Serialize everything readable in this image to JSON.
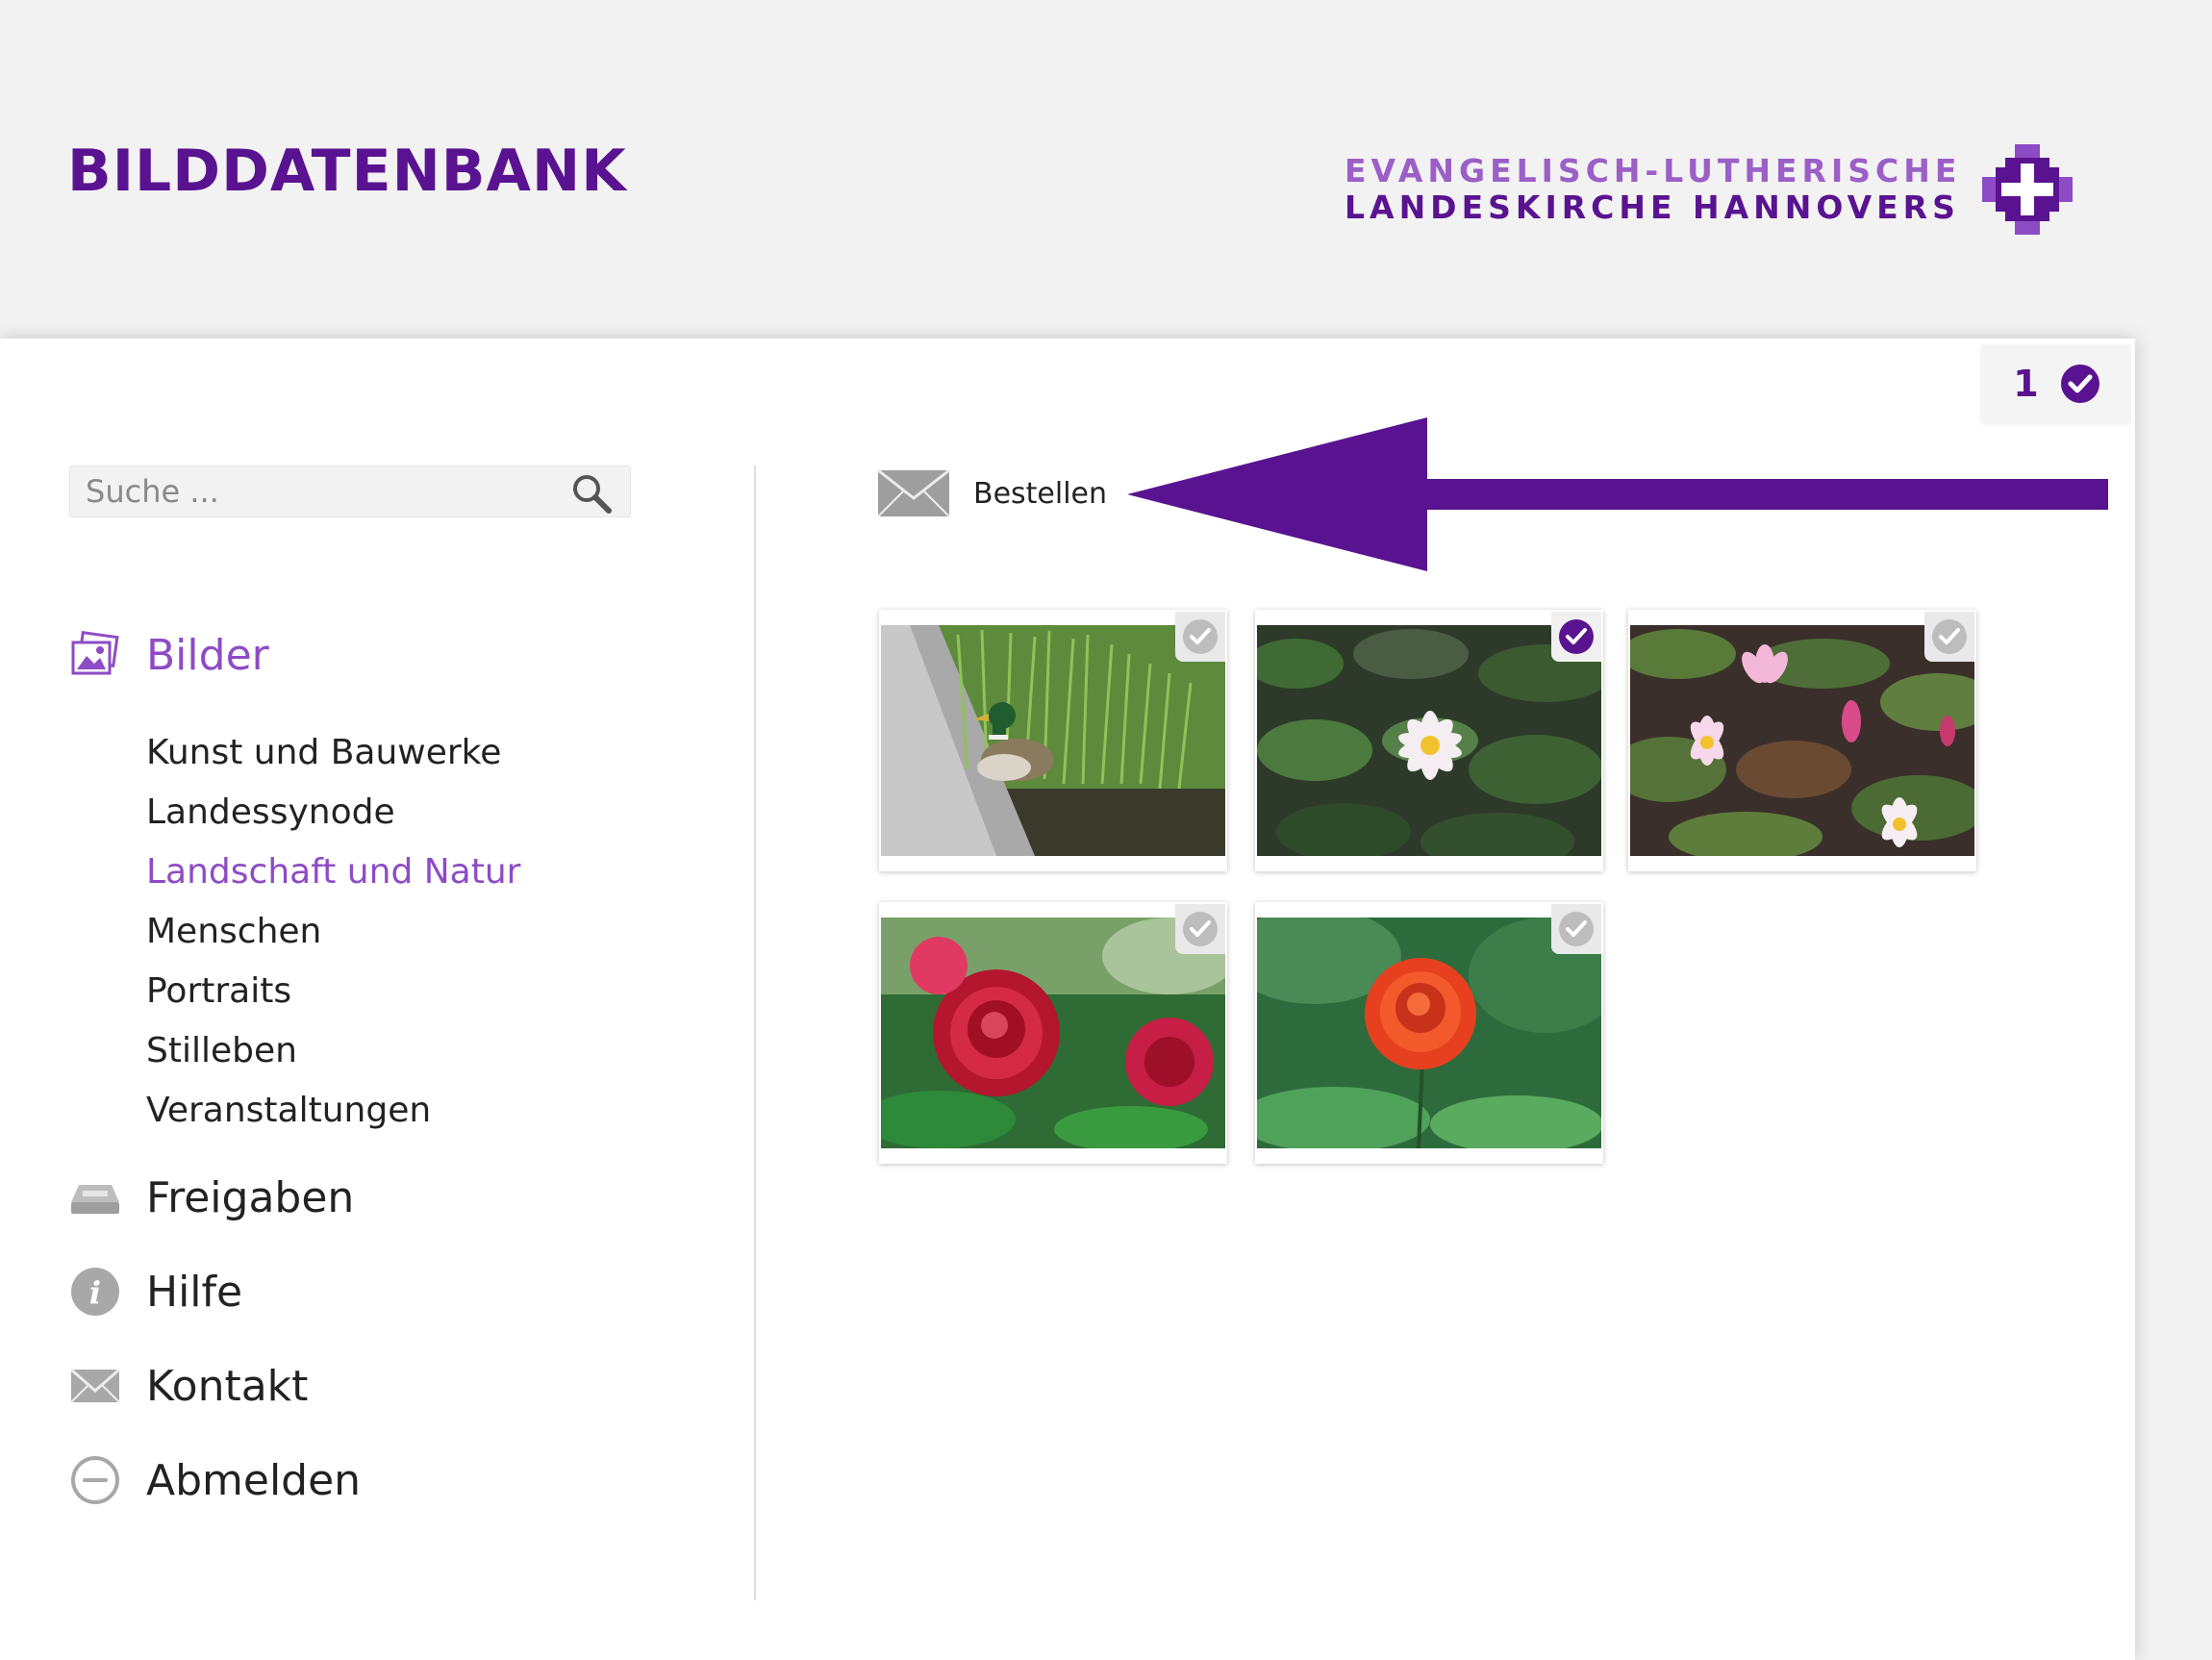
{
  "header": {
    "title": "BILDDATENBANK",
    "brand_line1": "EVANGELISCH-LUTHERISCHE",
    "brand_line2": "LANDESKIRCHE HANNOVERS",
    "brand_logo_icon": "cross-logo-icon"
  },
  "cart": {
    "count": "1",
    "icon": "check-circle-icon"
  },
  "search": {
    "placeholder": "Suche ...",
    "icon": "search-icon"
  },
  "sidebar": {
    "images": {
      "label": "Bilder",
      "icon": "images-icon"
    },
    "categories": [
      {
        "label": "Kunst und Bauwerke",
        "active": false
      },
      {
        "label": "Landessynode",
        "active": false
      },
      {
        "label": "Landschaft und Natur",
        "active": true
      },
      {
        "label": "Menschen",
        "active": false
      },
      {
        "label": "Portraits",
        "active": false
      },
      {
        "label": "Stilleben",
        "active": false
      },
      {
        "label": "Veranstaltungen",
        "active": false
      }
    ],
    "links": [
      {
        "label": "Freigaben",
        "icon": "inbox-tray-icon"
      },
      {
        "label": "Hilfe",
        "icon": "info-icon"
      },
      {
        "label": "Kontakt",
        "icon": "envelope-icon"
      },
      {
        "label": "Abmelden",
        "icon": "logout-minus-icon"
      }
    ]
  },
  "toolbar": {
    "order_label": "Bestellen",
    "order_icon": "envelope-icon"
  },
  "gallery": [
    {
      "subject": "duck",
      "selected": false
    },
    {
      "subject": "water-lily",
      "selected": true
    },
    {
      "subject": "water-lilies",
      "selected": false
    },
    {
      "subject": "red-roses",
      "selected": false
    },
    {
      "subject": "orange-rose",
      "selected": false
    }
  ],
  "colors": {
    "accent": "#5a1390",
    "accent_light": "#8e4bc6",
    "background": "#f2f2f2",
    "panel": "#ffffff"
  }
}
